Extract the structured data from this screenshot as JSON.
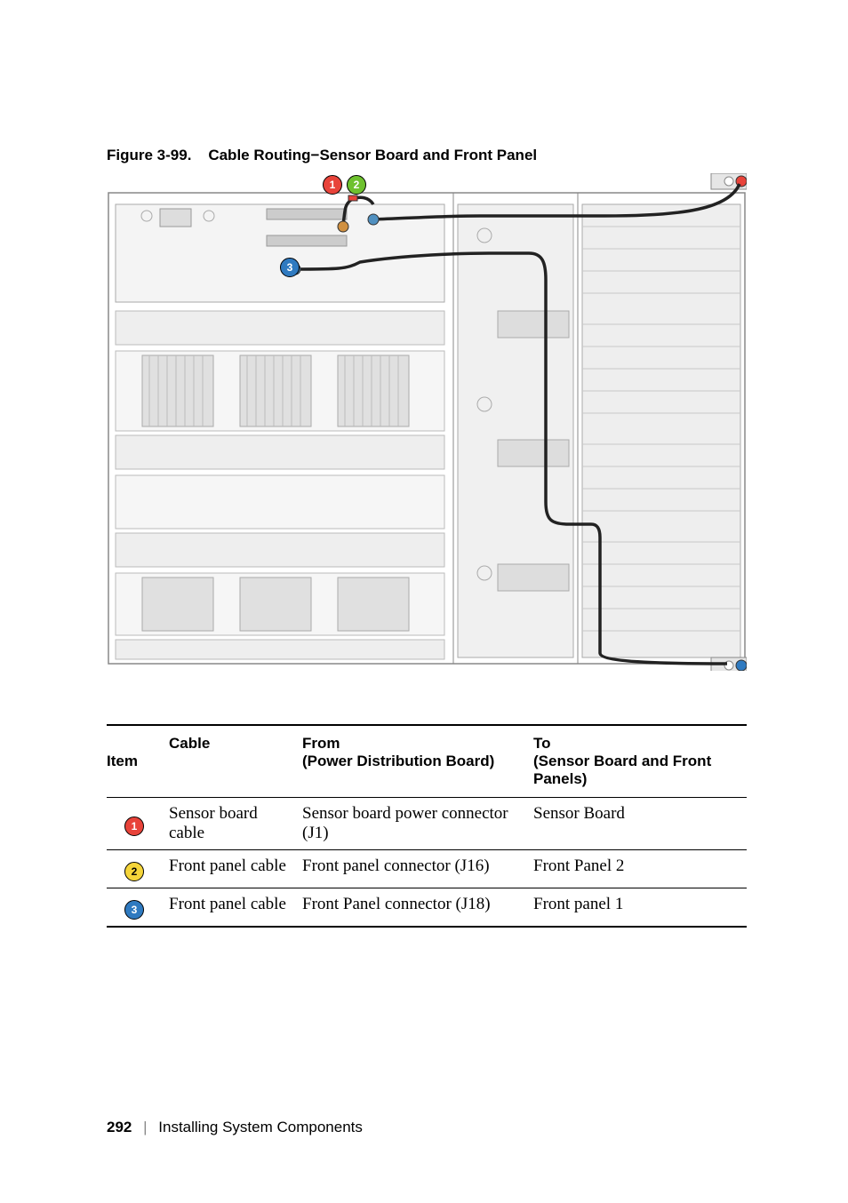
{
  "figure": {
    "caption_prefix": "Figure 3-99.",
    "caption_title": "Cable Routing−Sensor Board and Front Panel",
    "callouts": {
      "c1": "1",
      "c2": "2",
      "c3": "3"
    }
  },
  "table": {
    "headers": {
      "item": "Item",
      "cable": "Cable",
      "from_main": "From",
      "from_sub": "(Power Distribution Board)",
      "to_main": "To",
      "to_sub": "(Sensor Board and Front Panels)"
    },
    "rows": [
      {
        "badge": "1",
        "cable": "Sensor board cable",
        "from": "Sensor board power connector (J1)",
        "to": "Sensor Board"
      },
      {
        "badge": "2",
        "cable": "Front panel cable",
        "from": "Front panel connector (J16)",
        "to": "Front Panel 2"
      },
      {
        "badge": "3",
        "cable": "Front panel cable",
        "from": "Front Panel connector (J18)",
        "to": "Front panel 1"
      }
    ]
  },
  "footer": {
    "page_number": "292",
    "section": "Installing System Components"
  }
}
